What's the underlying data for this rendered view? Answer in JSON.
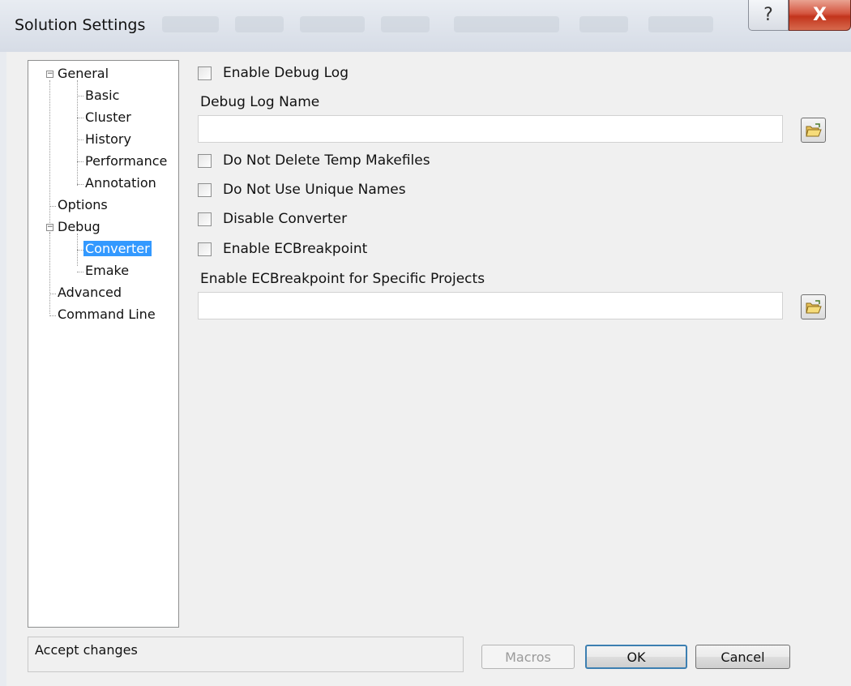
{
  "window": {
    "title": "Solution Settings",
    "help_glyph": "?",
    "close_glyph": "X"
  },
  "tree": {
    "items": [
      {
        "label": "General",
        "expanded": true
      },
      {
        "label": "Basic"
      },
      {
        "label": "Cluster"
      },
      {
        "label": "History"
      },
      {
        "label": "Performance"
      },
      {
        "label": "Annotation"
      },
      {
        "label": "Options"
      },
      {
        "label": "Debug",
        "expanded": true
      },
      {
        "label": "Converter",
        "selected": true
      },
      {
        "label": "Emake"
      },
      {
        "label": "Advanced"
      },
      {
        "label": "Command Line"
      }
    ]
  },
  "debug": {
    "enable_debug_log": "Enable Debug Log",
    "debug_log_name_label": "Debug Log Name",
    "debug_log_name_value": "",
    "do_not_delete_temp": "Do Not Delete Temp Makefiles",
    "do_not_use_unique": "Do Not Use Unique Names",
    "disable_converter": "Disable Converter",
    "enable_ecbreakpoint": "Enable ECBreakpoint",
    "ecbreakpoint_projects_label": "Enable ECBreakpoint for Specific Projects",
    "ecbreakpoint_projects_value": ""
  },
  "status": {
    "text": "Accept changes"
  },
  "buttons": {
    "macros": "Macros",
    "ok": "OK",
    "cancel": "Cancel"
  },
  "icons": {
    "browse": "folder-open-icon"
  }
}
